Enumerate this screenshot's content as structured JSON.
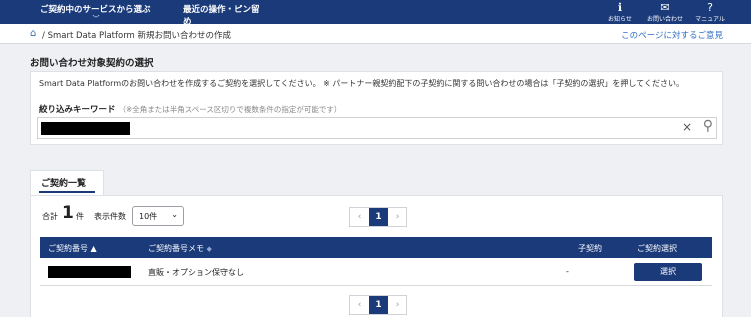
{
  "header": {
    "nav": [
      {
        "label": "ご契約中のサービスから選ぶ",
        "chevron": "﹀"
      },
      {
        "label": "最近の操作・ピン留め",
        "chevron": "﹀"
      }
    ],
    "icons": [
      {
        "glyph": "ℹ",
        "label": "お知らせ",
        "icon": "info-icon"
      },
      {
        "glyph": "✉",
        "label": "お問い合わせ",
        "icon": "mail-icon"
      },
      {
        "glyph": "?",
        "label": "マニュアル",
        "icon": "help-icon"
      }
    ]
  },
  "breadcrumb": {
    "home_glyph": "⌂",
    "text": "/ Smart Data Platform 新規お問い合わせの作成",
    "feedback_link": "このページに対するご意見"
  },
  "section": {
    "title": "お問い合わせ対象契約の選択",
    "description": "Smart Data Platformのお問い合わせを作成するご契約を選択してください。 ※ パートナー親契約配下の子契約に関する問い合わせの場合は「子契約の選択」を押してください。",
    "filter_label": "絞り込みキーワード",
    "filter_hint": "（※全角または半角スペース区切りで複数条件の指定が可能です）",
    "clear_glyph": "×",
    "search_glyph": "⚲"
  },
  "list": {
    "tab_label": "ご契約一覧",
    "total_label": "合計",
    "total_count": "1",
    "total_unit": "件",
    "page_size_label": "表示件数",
    "page_size_value": "10件",
    "page_size_caret": "⌄",
    "pager": {
      "prev": "‹",
      "current": "1",
      "next": "›"
    },
    "columns": [
      {
        "label": "ご契約番号",
        "sort": "▲"
      },
      {
        "label": "ご契約番号メモ",
        "sort": "◆"
      },
      {
        "label": "子契約",
        "sort": ""
      },
      {
        "label": "ご契約選択",
        "sort": ""
      }
    ],
    "rows": [
      {
        "memo": "直販・オプション保守なし",
        "child": "-",
        "action": "選択"
      }
    ]
  }
}
